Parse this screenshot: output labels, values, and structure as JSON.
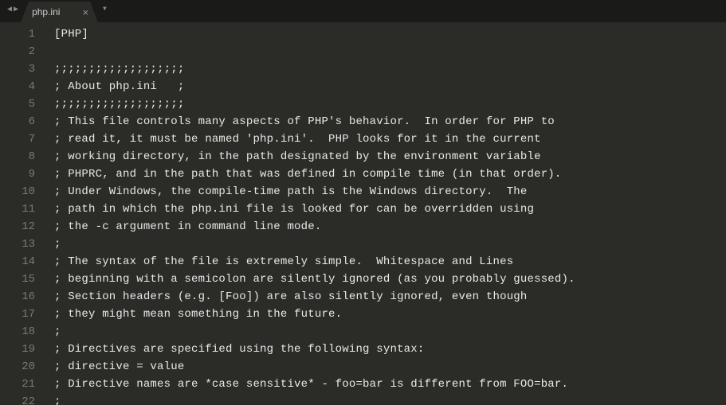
{
  "tab": {
    "label": "php.ini"
  },
  "code": {
    "lines": [
      {
        "num": "1",
        "text": "[PHP]",
        "cls": "section"
      },
      {
        "num": "2",
        "text": "",
        "cls": ""
      },
      {
        "num": "3",
        "text": ";;;;;;;;;;;;;;;;;;;",
        "cls": "comment"
      },
      {
        "num": "4",
        "text": "; About php.ini   ;",
        "cls": "comment"
      },
      {
        "num": "5",
        "text": ";;;;;;;;;;;;;;;;;;;",
        "cls": "comment"
      },
      {
        "num": "6",
        "text": "; This file controls many aspects of PHP's behavior.  In order for PHP to",
        "cls": "comment"
      },
      {
        "num": "7",
        "text": "; read it, it must be named 'php.ini'.  PHP looks for it in the current",
        "cls": "comment"
      },
      {
        "num": "8",
        "text": "; working directory, in the path designated by the environment variable",
        "cls": "comment"
      },
      {
        "num": "9",
        "text": "; PHPRC, and in the path that was defined in compile time (in that order).",
        "cls": "comment"
      },
      {
        "num": "10",
        "text": "; Under Windows, the compile-time path is the Windows directory.  The",
        "cls": "comment"
      },
      {
        "num": "11",
        "text": "; path in which the php.ini file is looked for can be overridden using",
        "cls": "comment"
      },
      {
        "num": "12",
        "text": "; the -c argument in command line mode.",
        "cls": "comment"
      },
      {
        "num": "13",
        "text": ";",
        "cls": "comment"
      },
      {
        "num": "14",
        "text": "; The syntax of the file is extremely simple.  Whitespace and Lines",
        "cls": "comment"
      },
      {
        "num": "15",
        "text": "; beginning with a semicolon are silently ignored (as you probably guessed).",
        "cls": "comment"
      },
      {
        "num": "16",
        "text": "; Section headers (e.g. [Foo]) are also silently ignored, even though",
        "cls": "comment"
      },
      {
        "num": "17",
        "text": "; they might mean something in the future.",
        "cls": "comment"
      },
      {
        "num": "18",
        "text": ";",
        "cls": "comment"
      },
      {
        "num": "19",
        "text": "; Directives are specified using the following syntax:",
        "cls": "comment"
      },
      {
        "num": "20",
        "text": "; directive = value",
        "cls": "comment"
      },
      {
        "num": "21",
        "text": "; Directive names are *case sensitive* - foo=bar is different from FOO=bar.",
        "cls": "comment"
      },
      {
        "num": "22",
        "text": ";",
        "cls": "comment"
      }
    ]
  }
}
